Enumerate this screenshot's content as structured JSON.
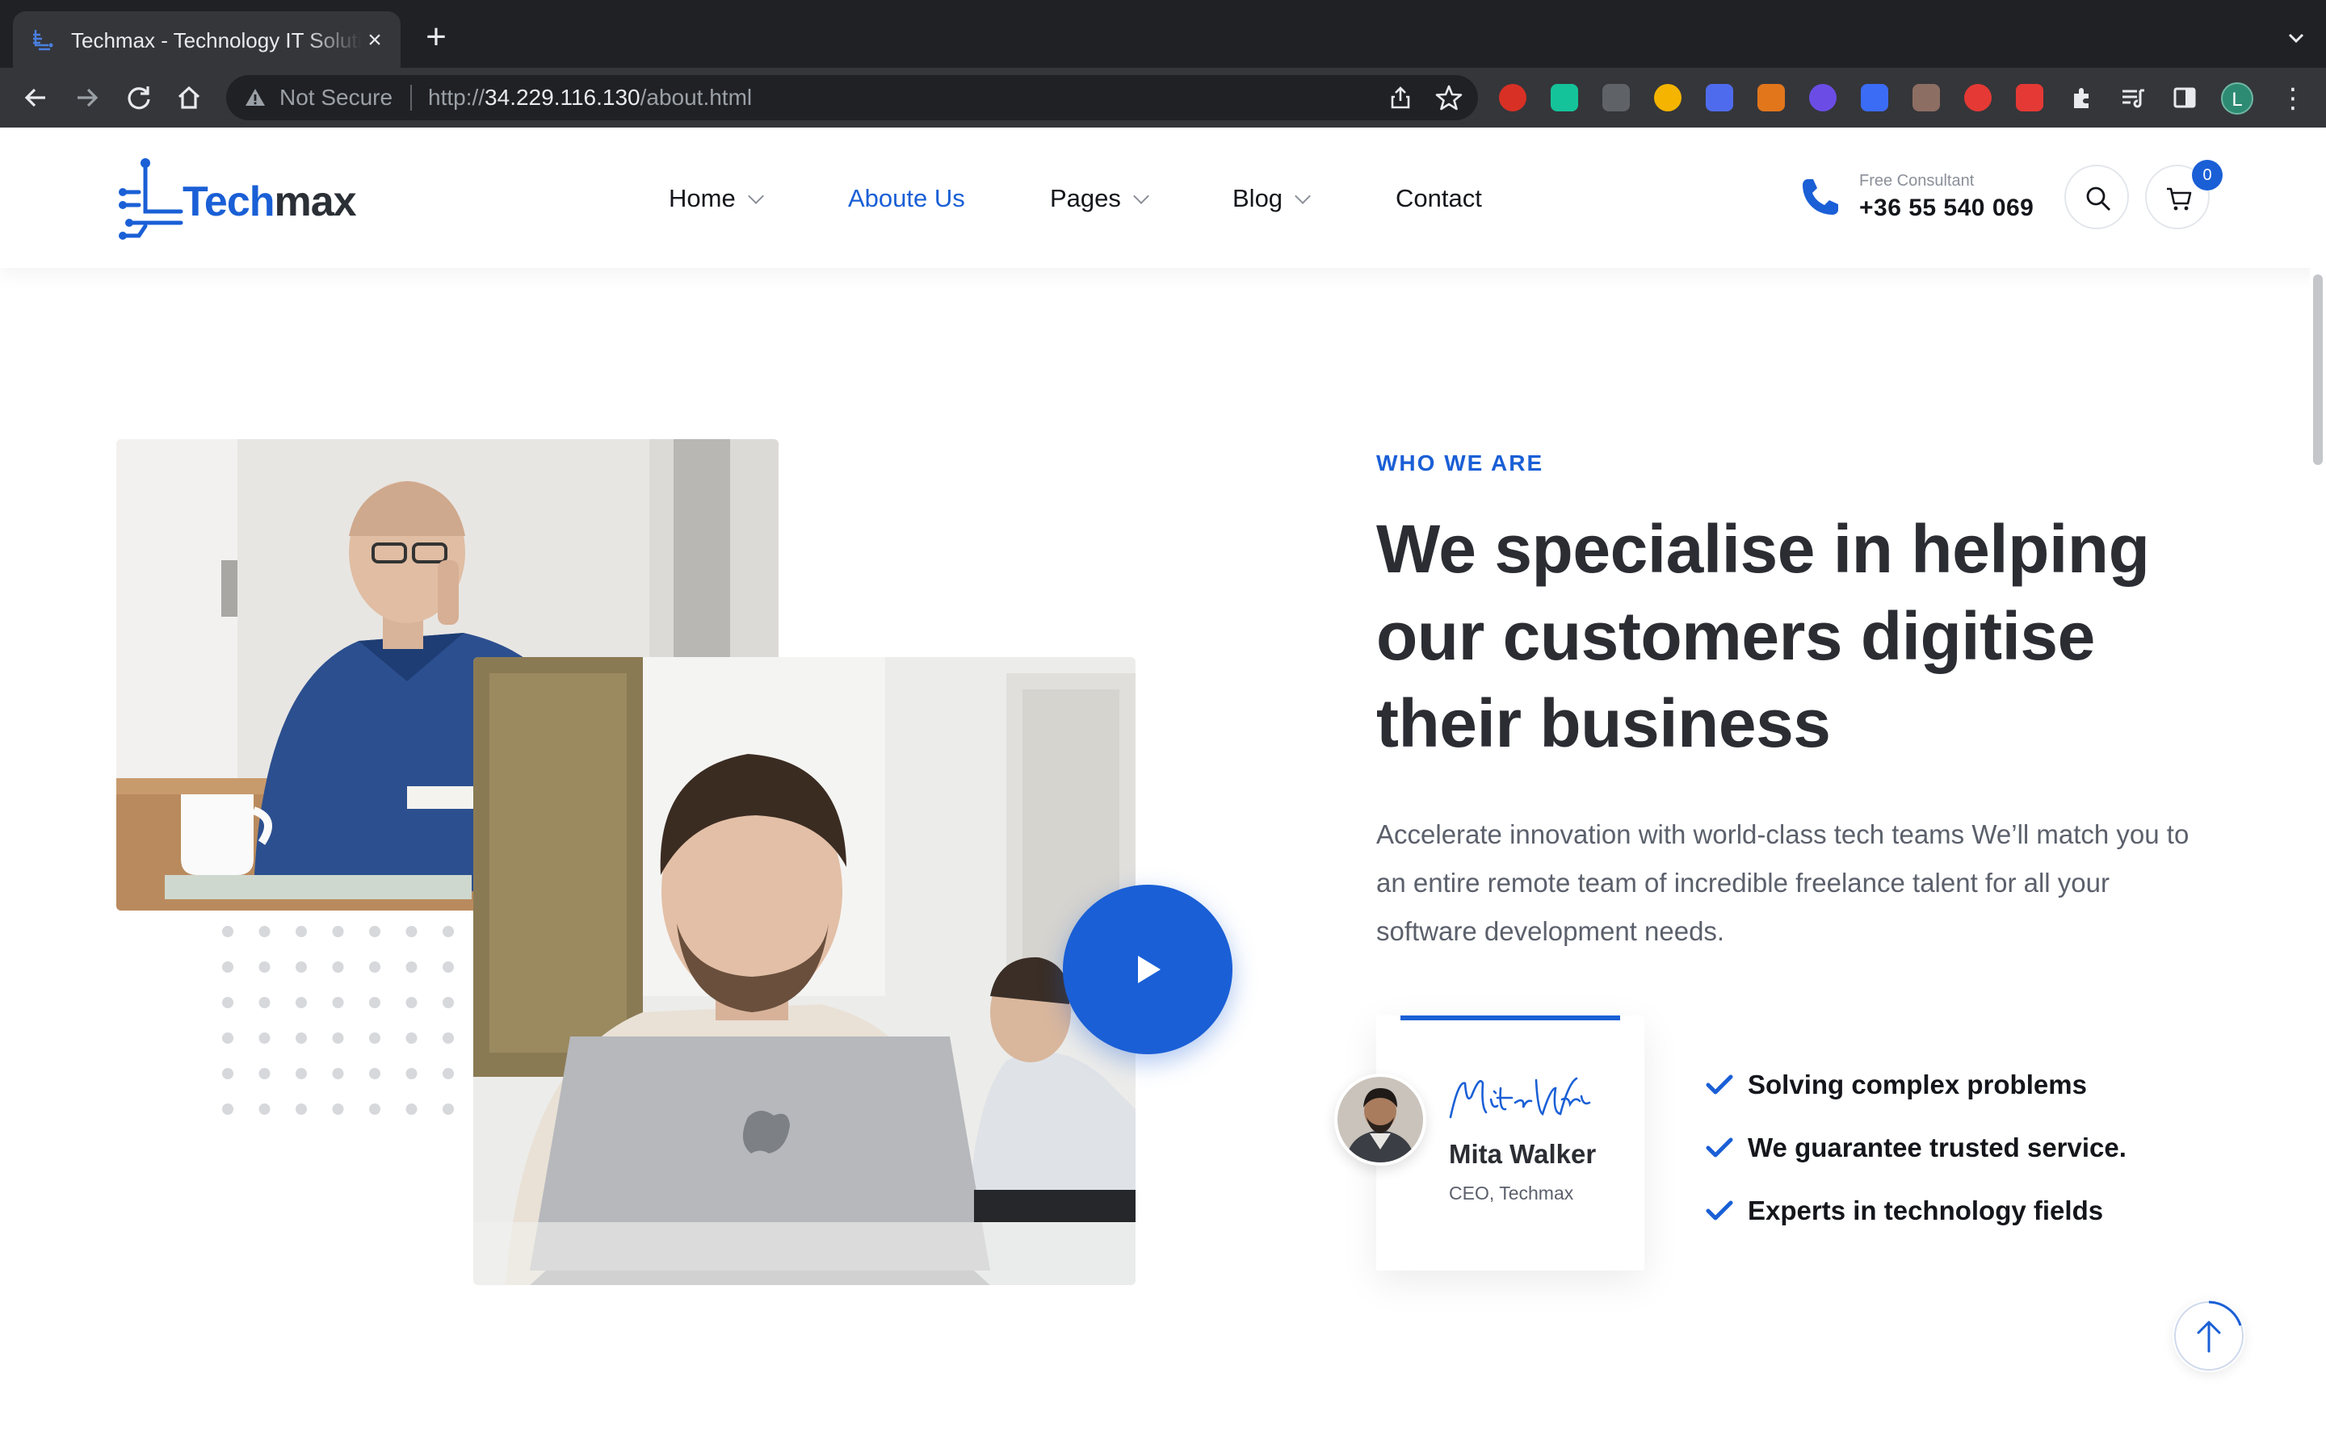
{
  "browser": {
    "tab_title": "Techmax - Technology IT Solutions",
    "tab_close": "×",
    "new_tab": "+",
    "security_label": "Not Secure",
    "url_scheme": "http://",
    "url_host": "34.229.116.130",
    "url_path": "/about.html",
    "profile_initial": "L",
    "menu_glyph": "⋮",
    "icons": [
      "back-icon",
      "forward-icon",
      "reload-icon",
      "home-icon",
      "warning-icon",
      "share-icon",
      "star-icon",
      "extensions-icon",
      "reading-list-icon",
      "side-panel-icon"
    ],
    "extensions": [
      {
        "name": "ext-red-shield-icon",
        "color": "#d93025"
      },
      {
        "name": "ext-grammarly-icon",
        "color": "#15c39a"
      },
      {
        "name": "ext-code-icon",
        "color": "#5f6368"
      },
      {
        "name": "ext-color-pinwheel-icon",
        "color": "#f4b400"
      },
      {
        "name": "ext-blue-burst-icon",
        "color": "#4f6bed"
      },
      {
        "name": "ext-fox-icon",
        "color": "#e2761b"
      },
      {
        "name": "ext-purple-bot-icon",
        "color": "#6b4de6"
      },
      {
        "name": "ext-blue-tag-icon",
        "color": "#3b6cf6"
      },
      {
        "name": "ext-owl-icon",
        "color": "#8d6e63"
      },
      {
        "name": "ext-red-video-icon",
        "color": "#e53935"
      },
      {
        "name": "ext-red-box-icon",
        "color": "#e53935"
      }
    ]
  },
  "site": {
    "logo_prefix": "Tech",
    "logo_suffix": "max",
    "nav": [
      {
        "label": "Home",
        "has_caret": true,
        "active": false
      },
      {
        "label": "Aboute Us",
        "has_caret": false,
        "active": true
      },
      {
        "label": "Pages",
        "has_caret": true,
        "active": false
      },
      {
        "label": "Blog",
        "has_caret": true,
        "active": false
      },
      {
        "label": "Contact",
        "has_caret": false,
        "active": false
      }
    ],
    "consult_label": "Free Consultant",
    "consult_phone": "+36 55 540 069",
    "cart_count": "0",
    "accent_color": "#1a5fd6"
  },
  "about": {
    "eyebrow": "WHO WE ARE",
    "headline": "We specialise in helping our customers digitise their business",
    "lead": "Accelerate innovation with world-class tech teams We’ll match you to an entire remote team of incredible freelance talent for all your software development needs.",
    "ceo_name": "Mita Walker",
    "ceo_role": "CEO, Techmax",
    "signature_text": "Mita Walker",
    "features": [
      "Solving complex problems",
      "We guarantee trusted service.",
      "Experts in technology fields"
    ]
  }
}
